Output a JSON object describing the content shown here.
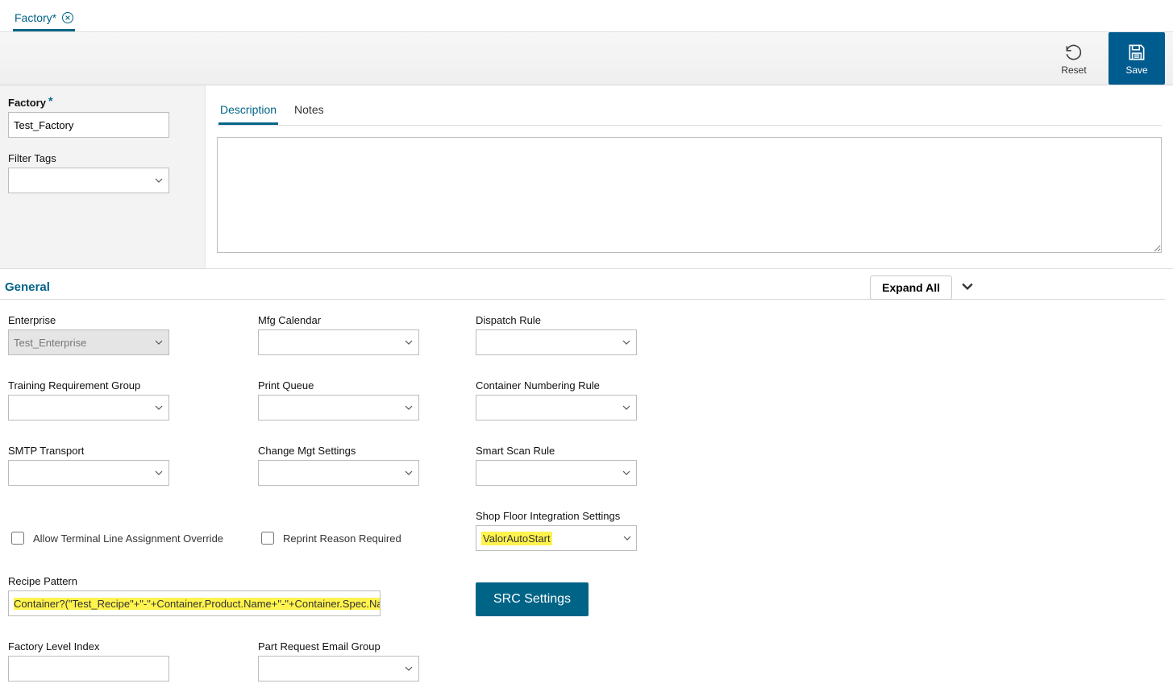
{
  "tab": {
    "label": "Factory*"
  },
  "toolbar": {
    "reset": "Reset",
    "save": "Save"
  },
  "left": {
    "factory_label": "Factory",
    "factory_value": "Test_Factory",
    "filter_tags_label": "Filter Tags",
    "filter_tags_value": ""
  },
  "inner_tabs": {
    "description": "Description",
    "notes": "Notes"
  },
  "description_value": "",
  "section": {
    "general": "General",
    "expand_all": "Expand All"
  },
  "fields": {
    "enterprise": {
      "label": "Enterprise",
      "value": "Test_Enterprise"
    },
    "mfg_calendar": {
      "label": "Mfg Calendar",
      "value": ""
    },
    "dispatch_rule": {
      "label": "Dispatch Rule",
      "value": ""
    },
    "training_req_group": {
      "label": "Training Requirement Group",
      "value": ""
    },
    "print_queue": {
      "label": "Print Queue",
      "value": ""
    },
    "container_numbering_rule": {
      "label": "Container Numbering Rule",
      "value": ""
    },
    "smtp_transport": {
      "label": "SMTP Transport",
      "value": ""
    },
    "change_mgt_settings": {
      "label": "Change Mgt Settings",
      "value": ""
    },
    "smart_scan_rule": {
      "label": "Smart Scan Rule",
      "value": ""
    },
    "allow_terminal": {
      "label": "Allow Terminal Line Assignment Override",
      "checked": false
    },
    "reprint_reason": {
      "label": "Reprint Reason Required",
      "checked": false
    },
    "shop_floor_integration": {
      "label": "Shop Floor Integration Settings",
      "value": "ValorAutoStart"
    },
    "recipe_pattern": {
      "label": "Recipe Pattern",
      "value": "Container?(\"Test_Recipe\"+\"-\"+Container.Product.Name+\"-\"+Container.Spec.Nam…"
    },
    "src_settings_btn": "SRC Settings",
    "factory_level_index": {
      "label": "Factory Level Index",
      "value": ""
    },
    "part_request_email_group": {
      "label": "Part Request Email Group",
      "value": ""
    }
  }
}
